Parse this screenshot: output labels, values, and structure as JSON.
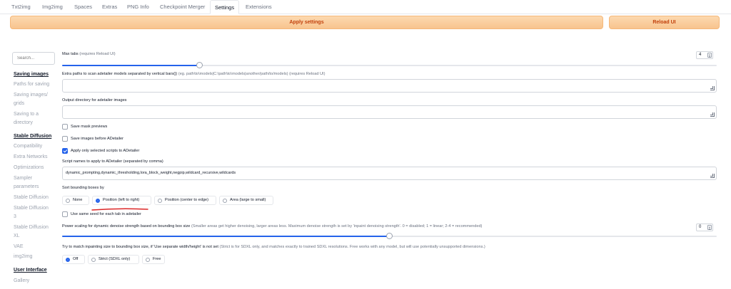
{
  "tabs": [
    "Txt2img",
    "Img2img",
    "Spaces",
    "Extras",
    "PNG Info",
    "Checkpoint Merger",
    "Settings",
    "Extensions"
  ],
  "active_tab": "Settings",
  "actions": {
    "apply": "Apply settings",
    "reload": "Reload UI"
  },
  "sidebar": {
    "search_placeholder": "Search...",
    "items": [
      {
        "label": "Saving images",
        "type": "heading"
      },
      {
        "label": "Paths for saving",
        "type": "item"
      },
      {
        "label": "Saving images/",
        "type": "item"
      },
      {
        "label": "grids",
        "type": "item"
      },
      {
        "label": "Saving to a",
        "type": "item"
      },
      {
        "label": "directory",
        "type": "item"
      },
      {
        "label": "Stable Diffusion",
        "type": "heading"
      },
      {
        "label": "Compatibility",
        "type": "item"
      },
      {
        "label": "Extra Networks",
        "type": "item"
      },
      {
        "label": "Optimizations",
        "type": "item"
      },
      {
        "label": "Sampler",
        "type": "item"
      },
      {
        "label": "parameters",
        "type": "item"
      },
      {
        "label": "Stable Diffusion",
        "type": "item"
      },
      {
        "label": "Stable Diffusion",
        "type": "item"
      },
      {
        "label": "3",
        "type": "item"
      },
      {
        "label": "Stable Diffusion",
        "type": "item"
      },
      {
        "label": "XL",
        "type": "item"
      },
      {
        "label": "VAE",
        "type": "item"
      },
      {
        "label": "img2img",
        "type": "item"
      },
      {
        "label": "User Interface",
        "type": "heading"
      },
      {
        "label": "Gallery",
        "type": "item"
      }
    ]
  },
  "settings": {
    "max_tabs": {
      "label": "Max tabs",
      "hint": "(requires Reload UI)",
      "value": "4",
      "fraction": 0.21
    },
    "extra_paths": {
      "label": "Extra paths to scan adetailer models separated by vertical bars(|)",
      "hint": "(eg. path\\to\\models|C:\\path\\to\\models|another/path/to/models) (requires Reload UI)",
      "value": ""
    },
    "output_dir": {
      "label": "Output directory for adetailer images",
      "value": ""
    },
    "save_mask_previews": {
      "label": "Save mask previews",
      "checked": false
    },
    "save_before": {
      "label": "Save images before ADetailer",
      "checked": false
    },
    "apply_selected": {
      "label": "Apply only selected scripts to ADetailer",
      "checked": true
    },
    "script_names": {
      "label": "Script names to apply to ADetailer (separated by comma)",
      "value": "dynamic_prompting,dynamic_thresholding,lora_block_weight,negpip,wildcard_recursive,wildcards"
    },
    "sort_bbox": {
      "label": "Sort bounding boxes by",
      "options": [
        "None",
        "Position (left to right)",
        "Position (center to edge)",
        "Area (large to small)"
      ],
      "selected": "Position (left to right)"
    },
    "same_seed": {
      "label": "Use same seed for each tab in adetailer",
      "checked": false
    },
    "power_scaling": {
      "label": "Power scaling for dynamic denoise strength based on bounding box size",
      "hint": "(Smaller areas get higher denoising, larger areas less. Maximum denoise strength is set by 'inpaint denoising strength'. 0 = disabled; 1 = linear; 2-4 = recommended)",
      "value": "0",
      "fraction": 0.5
    },
    "match_size": {
      "label": "Try to match inpainting size to bounding box size, if 'Use separate width/height' is not set",
      "hint": "(Strict is for SDXL only, and matches exactly to trained SDXL resolutions. Free works with any model, but will use potentially unsupported dimensions.)",
      "options": [
        "Off",
        "Strict (SDXL only)",
        "Free"
      ],
      "selected": "Off"
    }
  },
  "colors": {
    "accent": "#2563eb",
    "apply_bg": "#f8c48e",
    "apply_text": "#c2410c",
    "annotation": "#dc2626"
  }
}
